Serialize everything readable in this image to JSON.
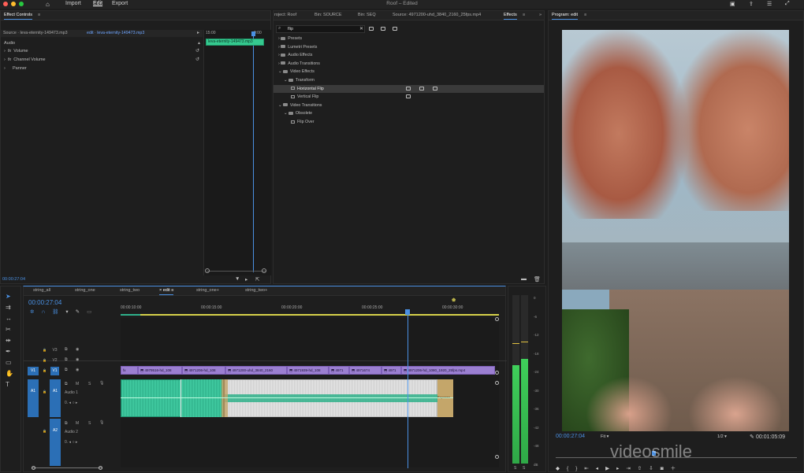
{
  "titlebar": {
    "menu": [
      "Import",
      "Edit",
      "Export"
    ],
    "active_menu": "Edit",
    "title": "Roof – Edited"
  },
  "effect_controls": {
    "tab": "Effect Controls",
    "source_label": "Source · leva-eternity-149473.mp3",
    "seq_label": "edit · leva-eternity-149473.mp3",
    "time_marker": "15:00",
    "time_marker2": "0:00",
    "clip_name": "leva-eternity-149473.mp3",
    "section": "Audio",
    "rows": [
      "Volume",
      "Channel Volume",
      "Panner"
    ],
    "timecode": "00:00:27:04"
  },
  "effects_panel": {
    "tabs": [
      "roject: Roof",
      "Bin: SOURCE",
      "Bin: SEQ",
      "Source: 4971200-uhd_3840_2160_25fps.mp4",
      "Effects"
    ],
    "active_tab": "Effects",
    "search_value": "flip",
    "tree": [
      {
        "label": "Presets",
        "level": 0,
        "open": false,
        "type": "folder"
      },
      {
        "label": "Lumetri Presets",
        "level": 0,
        "open": false,
        "type": "folder"
      },
      {
        "label": "Audio Effects",
        "level": 0,
        "open": false,
        "type": "folder"
      },
      {
        "label": "Audio Transitions",
        "level": 0,
        "open": false,
        "type": "folder"
      },
      {
        "label": "Video Effects",
        "level": 0,
        "open": true,
        "type": "folder"
      },
      {
        "label": "Transform",
        "level": 1,
        "open": true,
        "type": "folder"
      },
      {
        "label": "Horizontal Flip",
        "level": 2,
        "type": "effect",
        "selected": true,
        "badges": 3
      },
      {
        "label": "Vertical Flip",
        "level": 2,
        "type": "effect",
        "badges": 1
      },
      {
        "label": "Video Transitions",
        "level": 0,
        "open": true,
        "type": "folder"
      },
      {
        "label": "Obsolete",
        "level": 1,
        "open": true,
        "type": "folder"
      },
      {
        "label": "Flip Over",
        "level": 2,
        "type": "effect"
      }
    ]
  },
  "program": {
    "title": "Program: edit",
    "timecode": "00:00:27:04",
    "fit": "Fit",
    "resolution": "1/2",
    "duration": "00:01:05:09"
  },
  "timeline": {
    "tabs": [
      "string_all",
      "string_one",
      "string_two",
      "edit",
      "string_one+",
      "string_two+"
    ],
    "active_tab": "edit",
    "timecode": "00:00:27:04",
    "ruler": [
      "00:00:10:00",
      "00:00:15:00",
      "00:00:20:00",
      "00:00:25:00",
      "00:00:30:00"
    ],
    "video_tracks": [
      "V3",
      "V2",
      "V1"
    ],
    "audio_tracks": [
      {
        "id": "A1",
        "name": "Audio 1"
      },
      {
        "id": "A2",
        "name": "Audio 2"
      }
    ],
    "clips_v1": [
      "fx",
      "4979516-hd_108",
      "4971206-hd_108",
      "4971200-uhd_3840_2160",
      "4971939-hd_108",
      "4971",
      "4971674",
      "4971",
      "4971206-hd_1080_1920_25fps.mp4"
    ],
    "audio_knob": "0."
  },
  "vu_scale": [
    "0",
    "-6",
    "-12",
    "-18",
    "-24",
    "-30",
    "-36",
    "-42",
    "-48",
    "dB"
  ],
  "vu_footer": [
    "S",
    "S"
  ],
  "watermark": "videosmile"
}
